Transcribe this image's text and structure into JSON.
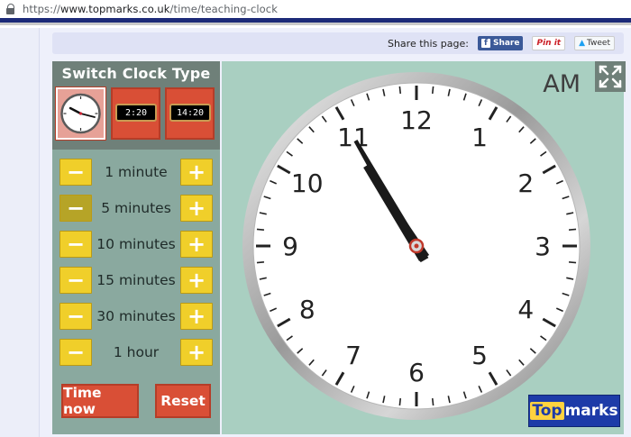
{
  "browser": {
    "url_prefix": "https://",
    "url_domain": "www.topmarks.co.uk",
    "url_path": "/time/teaching-clock"
  },
  "share": {
    "label": "Share this page:",
    "facebook": "Share",
    "pinterest": "Pin it",
    "twitter": "Tweet"
  },
  "panel": {
    "title": "Switch Clock Type",
    "types": [
      {
        "name": "analogue",
        "active": true
      },
      {
        "name": "digital-12h",
        "display": "2:20"
      },
      {
        "name": "digital-24h",
        "display": "14:20"
      }
    ],
    "steps": [
      {
        "label": "1 minute"
      },
      {
        "label": "5 minutes"
      },
      {
        "label": "10 minutes"
      },
      {
        "label": "15 minutes"
      },
      {
        "label": "30 minutes"
      },
      {
        "label": "1 hour"
      }
    ],
    "time_now": "Time now",
    "reset": "Reset"
  },
  "clock": {
    "period": "AM",
    "hour": 10,
    "minute": 55,
    "numbers": [
      "12",
      "1",
      "2",
      "3",
      "4",
      "5",
      "6",
      "7",
      "8",
      "9",
      "10",
      "11"
    ]
  },
  "brand": {
    "top": "Top",
    "marks": "marks"
  },
  "colors": {
    "panel": "#8aa99f",
    "panel_header": "#6f8079",
    "clock_bg": "#a9cfc1",
    "button_red": "#d94f36",
    "button_yellow": "#f0cf2a",
    "brand_blue": "#1d3ba8"
  },
  "icons": {
    "lock": "lock-icon",
    "fullscreen": "expand-icon",
    "minus": "minus-icon",
    "plus": "plus-icon"
  }
}
